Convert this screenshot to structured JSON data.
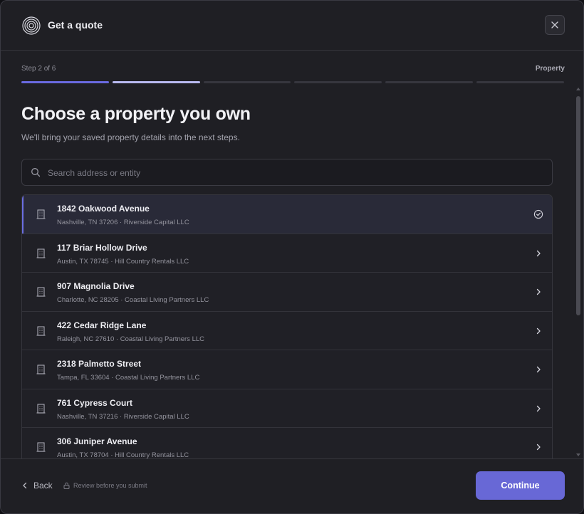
{
  "header": {
    "title": "Get a quote",
    "close_label": "Close"
  },
  "progress": {
    "step_text": "Step 2 of 6",
    "step_name": "Property",
    "segments": [
      {
        "state": "complete",
        "color": "#6a6ae0"
      },
      {
        "state": "current",
        "color": "#b8b9f0"
      },
      {
        "state": "upcoming",
        "color": "#36363e"
      },
      {
        "state": "upcoming",
        "color": "#36363e"
      },
      {
        "state": "upcoming",
        "color": "#36363e"
      },
      {
        "state": "upcoming",
        "color": "#36363e"
      }
    ]
  },
  "main": {
    "heading": "Choose a property you own",
    "subheading": "We'll bring your saved property details into the next steps.",
    "search": {
      "placeholder": "Search address or entity",
      "value": "",
      "icon": "search-icon"
    },
    "properties": [
      {
        "address": "1842 Oakwood Avenue",
        "meta": "Nashville, TN 37206 · Riverside Capital LLC",
        "selected": true
      },
      {
        "address": "117 Briar Hollow Drive",
        "meta": "Austin, TX 78745 · Hill Country Rentals LLC",
        "selected": false
      },
      {
        "address": "907 Magnolia Drive",
        "meta": "Charlotte, NC 28205 · Coastal Living Partners LLC",
        "selected": false
      },
      {
        "address": "422 Cedar Ridge Lane",
        "meta": "Raleigh, NC 27610 · Coastal Living Partners LLC",
        "selected": false
      },
      {
        "address": "2318 Palmetto Street",
        "meta": "Tampa, FL 33604 · Coastal Living Partners LLC",
        "selected": false
      },
      {
        "address": "761 Cypress Court",
        "meta": "Nashville, TN 37216 · Riverside Capital LLC",
        "selected": false
      },
      {
        "address": "306 Juniper Avenue",
        "meta": "Austin, TX 78704 · Hill Country Rentals LLC",
        "selected": false
      }
    ]
  },
  "footer": {
    "back_label": "Back",
    "review_note": "Review before you submit",
    "continue_label": "Continue"
  },
  "colors": {
    "accent": "#6868d6",
    "background": "#1f1f24",
    "selected_row": "#292a38"
  }
}
